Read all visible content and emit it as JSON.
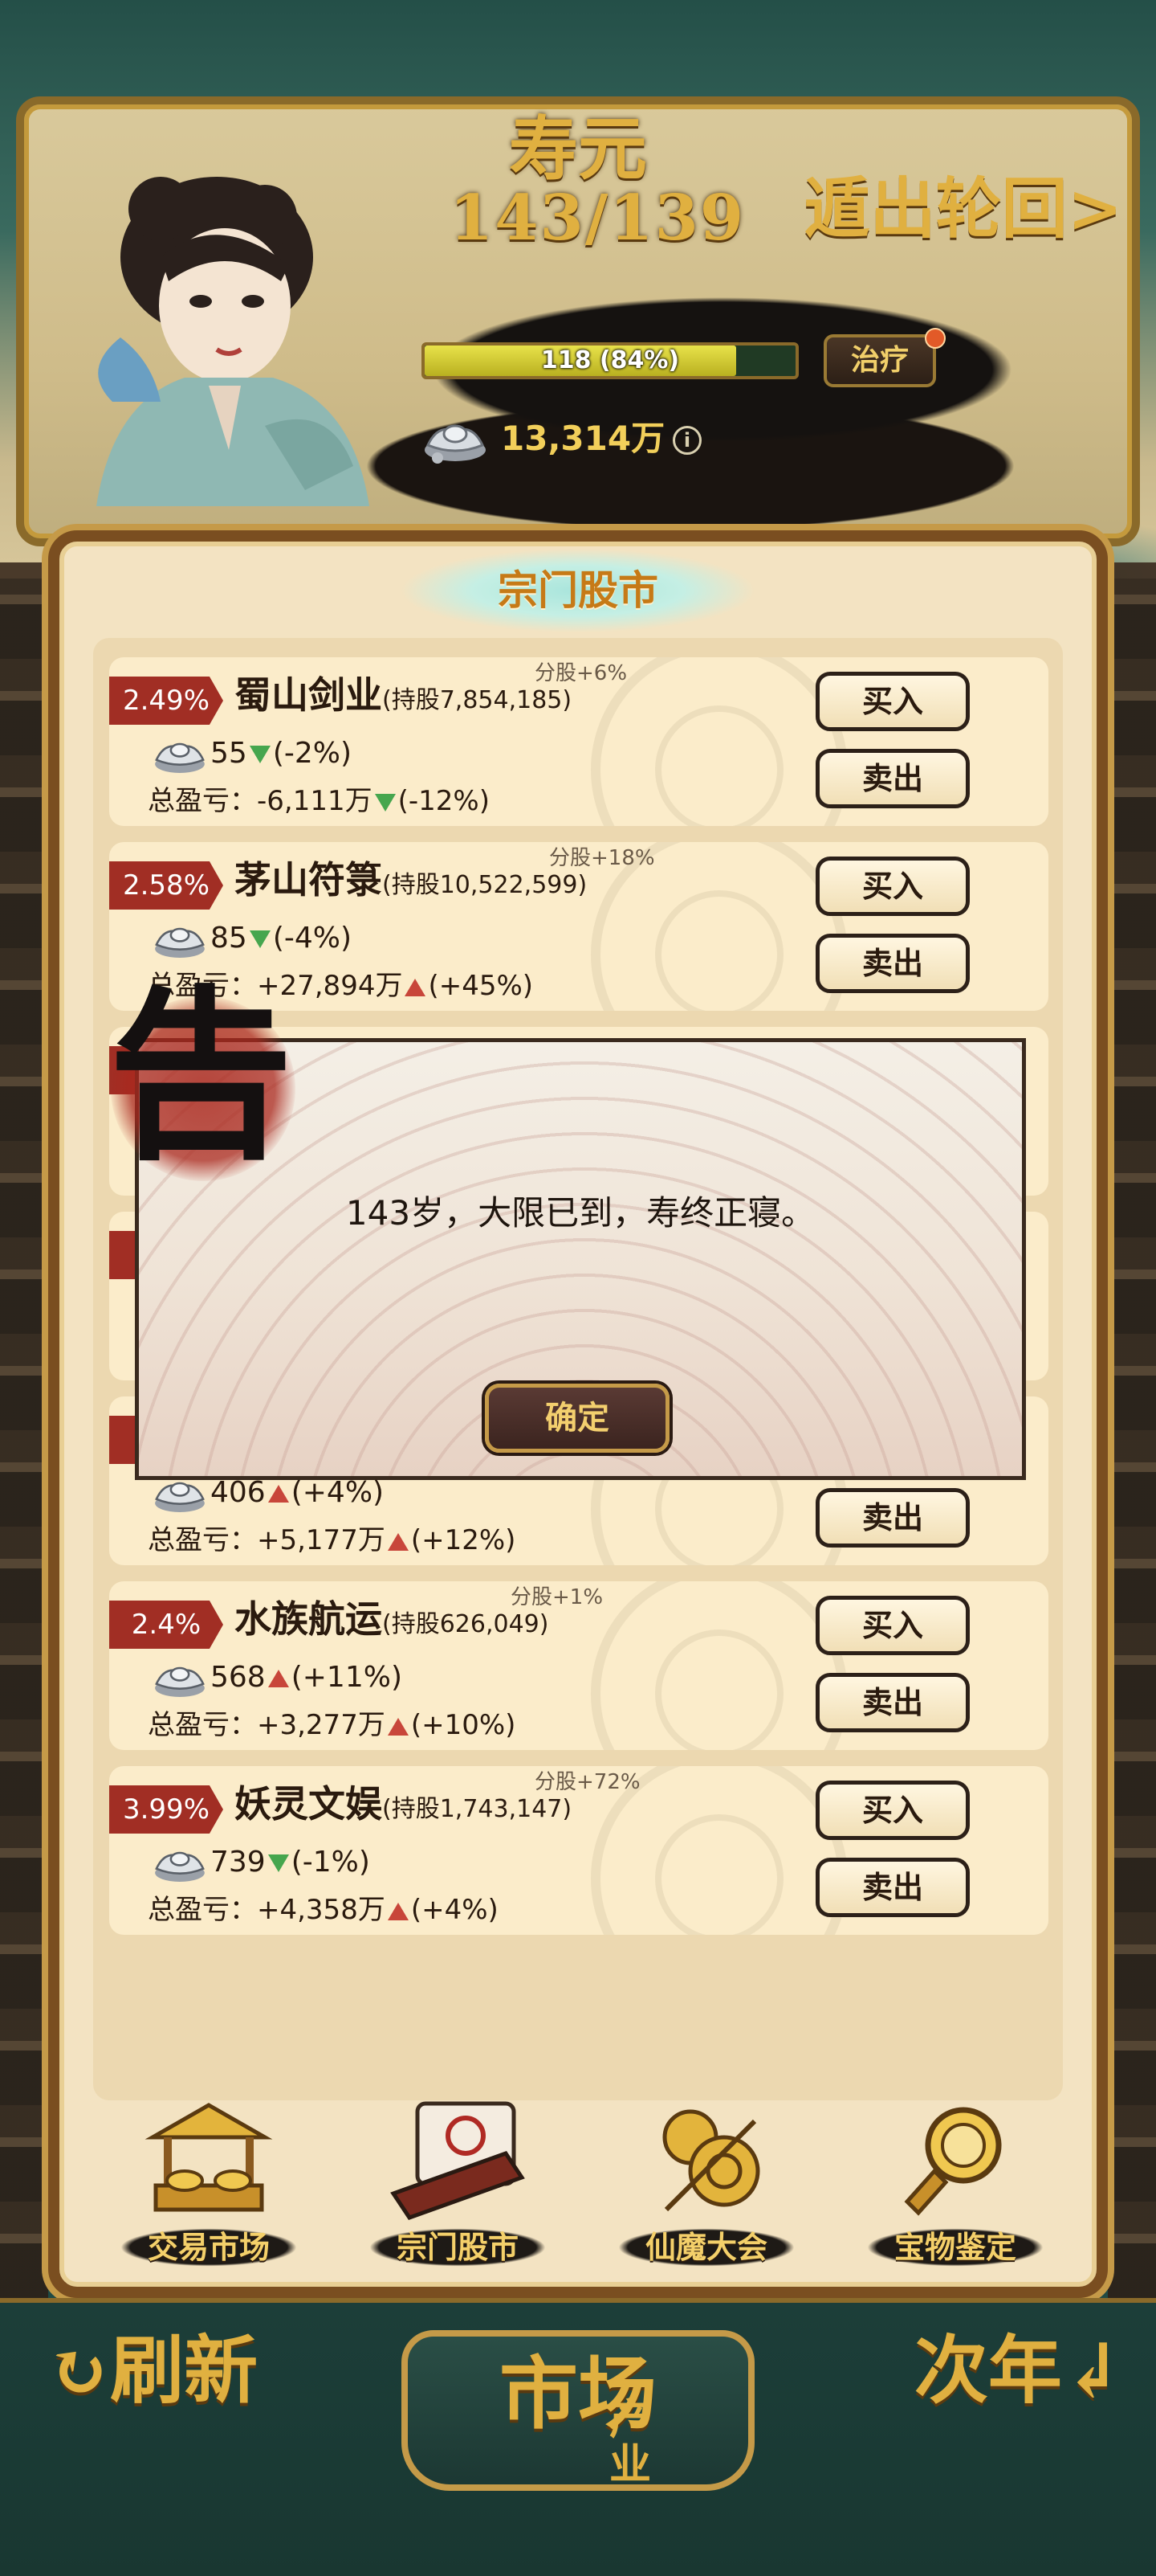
{
  "header": {
    "lifespan_title": "寿元",
    "lifespan_value": "143/139",
    "exit_label": "遁出轮回>",
    "hp_text": "118 (84%)",
    "hp_fraction": 0.84,
    "heal_label": "治疗",
    "money": "13,314万",
    "info_icon": "i"
  },
  "panel": {
    "title": "宗门股市"
  },
  "stocks": [
    {
      "rate": "2.49%",
      "name": "蜀山剑业",
      "holding": "(持股7,854,185)",
      "dividend": "分股+6%",
      "price": "55",
      "price_change": "(-2%)",
      "price_dir": "down",
      "pnl_label": "总盈亏：",
      "pnl": "-6,111万",
      "pnl_change": "(-12%)",
      "pnl_dir": "down",
      "buy": "买入",
      "sell": "卖出"
    },
    {
      "rate": "2.58%",
      "name": "茅山符箓",
      "holding": "(持股10,522,599)",
      "dividend": "分股+18%",
      "price": "85",
      "price_change": "(-4%)",
      "price_dir": "down",
      "pnl_label": "总盈亏：",
      "pnl": "+27,894万",
      "pnl_change": "(+45%)",
      "pnl_dir": "up",
      "buy": "买入",
      "sell": "卖出"
    },
    {
      "rate": "",
      "name": "",
      "holding": "",
      "dividend": "",
      "price": "",
      "price_change": "",
      "price_dir": "",
      "pnl_label": "",
      "pnl": "",
      "pnl_change": "",
      "pnl_dir": "",
      "buy": "",
      "sell": ""
    },
    {
      "rate": "",
      "name": "",
      "holding": "",
      "dividend": "",
      "price": "",
      "price_change": "",
      "price_dir": "",
      "pnl_label": "",
      "pnl": "",
      "pnl_change": "",
      "pnl_dir": "",
      "buy": "",
      "sell": ""
    },
    {
      "rate": "",
      "name": "",
      "holding": "",
      "dividend": "",
      "price": "406",
      "price_change": "(+4%)",
      "price_dir": "up",
      "pnl_label": "总盈亏：",
      "pnl": "+5,177万",
      "pnl_change": "(+12%)",
      "pnl_dir": "up",
      "buy": "",
      "sell": "卖出"
    },
    {
      "rate": "2.4%",
      "name": "水族航运",
      "holding": "(持股626,049)",
      "dividend": "分股+1%",
      "price": "568",
      "price_change": "(+11%)",
      "price_dir": "up",
      "pnl_label": "总盈亏：",
      "pnl": "+3,277万",
      "pnl_change": "(+10%)",
      "pnl_dir": "up",
      "buy": "买入",
      "sell": "卖出"
    },
    {
      "rate": "3.99%",
      "name": "妖灵文娱",
      "holding": "(持股1,743,147)",
      "dividend": "分股+72%",
      "price": "739",
      "price_change": "(-1%)",
      "price_dir": "down",
      "pnl_label": "总盈亏：",
      "pnl": "+4,358万",
      "pnl_change": "(+4%)",
      "pnl_dir": "up",
      "buy": "买入",
      "sell": "卖出"
    }
  ],
  "modal": {
    "seal_char": "告",
    "message": "143岁，大限已到，寿终正寝。",
    "ok_label": "确定"
  },
  "bottom_nav": [
    {
      "label": "交易市场",
      "icon": "market-stall-icon"
    },
    {
      "label": "宗门股市",
      "icon": "scroll-stock-icon"
    },
    {
      "label": "仙魔大会",
      "icon": "gourd-emblem-icon"
    },
    {
      "label": "宝物鉴定",
      "icon": "magnifier-icon"
    }
  ],
  "bottom_bar": {
    "refresh_label": "刷新",
    "center_label": "市场",
    "center_sub": "产业",
    "next_year_label": "次年"
  },
  "colors": {
    "gold": "#e0b040",
    "panel_bg": "#f3e3c2",
    "rate_tag": "#a12e24",
    "up": "#c8463a",
    "down": "#46a64e"
  }
}
